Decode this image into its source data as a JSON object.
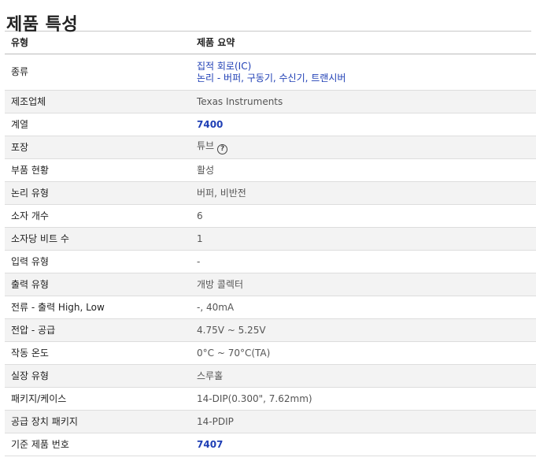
{
  "title": "제품 특성",
  "header": {
    "col1": "유형",
    "col2": "제품 요약"
  },
  "rows": {
    "type": {
      "label": "종류",
      "link1": "집적 회로(IC)",
      "link2": "논리 - 버퍼, 구동기, 수신기, 트랜시버"
    },
    "mfr": {
      "label": "제조업체",
      "value": "Texas Instruments"
    },
    "series": {
      "label": "계열",
      "value": "7400"
    },
    "packaging": {
      "label": "포장",
      "value": "튜브",
      "icon": "question-circle-icon"
    },
    "status": {
      "label": "부품 현황",
      "value": "활성"
    },
    "logic_type": {
      "label": "논리 유형",
      "value": "버퍼, 비반전"
    },
    "elements": {
      "label": "소자 개수",
      "value": "6"
    },
    "bits": {
      "label": "소자당 비트 수",
      "value": "1"
    },
    "input_type": {
      "label": "입력 유형",
      "value": "-"
    },
    "output_type": {
      "label": "출력 유형",
      "value": "개방 콜렉터"
    },
    "current": {
      "label": "전류 - 출력 High, Low",
      "value": "-, 40mA"
    },
    "voltage": {
      "label": "전압 - 공급",
      "value": "4.75V ~ 5.25V"
    },
    "temp": {
      "label": "작동 온도",
      "value": "0°C ~ 70°C(TA)"
    },
    "mounting": {
      "label": "실장 유형",
      "value": "스루홀"
    },
    "package": {
      "label": "패키지/케이스",
      "value": "14-DIP(0.300\", 7.62mm)"
    },
    "supplier_pkg": {
      "label": "공급 장치 패키지",
      "value": "14-PDIP"
    },
    "base_part": {
      "label": "기준 제품 번호",
      "value": "7407"
    }
  },
  "colors": {
    "link": "#1f3fb5",
    "row_shade": "#f3f3f3"
  }
}
